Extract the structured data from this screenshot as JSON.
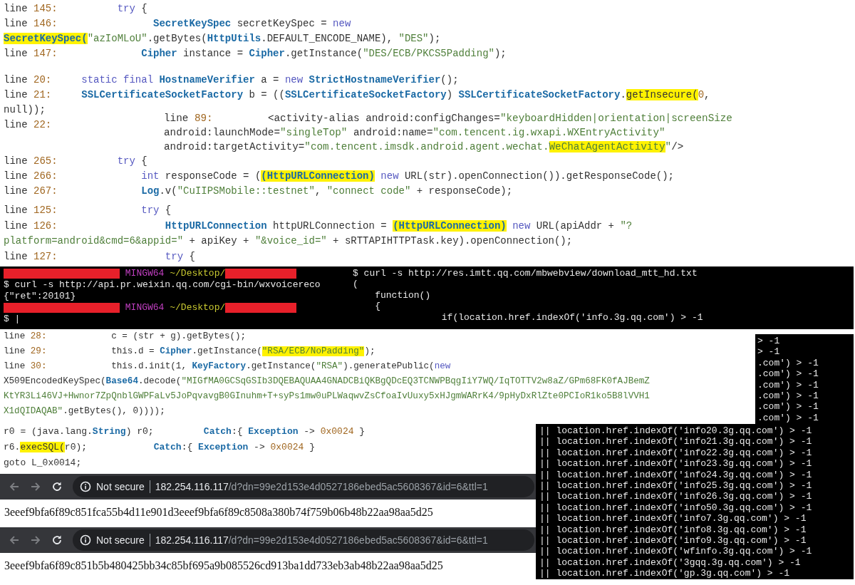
{
  "panels": [
    {
      "kind": "code",
      "lines": [
        {
          "label": "line",
          "number": "145:",
          "segments": [
            {
              "text": "          try",
              "kind": "keyword"
            },
            {
              "text": " {",
              "kind": "plain"
            }
          ]
        },
        {
          "label": "line",
          "number": "146:",
          "segments": [
            {
              "text": "                SecretKeySpec",
              "kind": "type"
            },
            {
              "text": " secretKeySpec = ",
              "kind": "plain"
            },
            {
              "text": "new",
              "kind": "keyword"
            }
          ]
        },
        {
          "segments": [
            {
              "text": "SecretKeySpec(",
              "kind": "type",
              "highlighted": true
            },
            {
              "text": "\"azIoMLoU\"",
              "kind": "string"
            },
            {
              "text": ".getBytes(",
              "kind": "plain"
            },
            {
              "text": "HttpUtils",
              "kind": "type"
            },
            {
              "text": ".DEFAULT_ENCODE_NAME), ",
              "kind": "plain"
            },
            {
              "text": "\"DES\"",
              "kind": "string"
            },
            {
              "text": ");",
              "kind": "plain"
            }
          ]
        },
        {
          "label": "line",
          "number": "147:",
          "segments": [
            {
              "text": "              Cipher",
              "kind": "type"
            },
            {
              "text": " instance = ",
              "kind": "plain"
            },
            {
              "text": "Cipher",
              "kind": "type"
            },
            {
              "text": ".getInstance(",
              "kind": "plain"
            },
            {
              "text": "\"DES/ECB/PKCS5Padding\"",
              "kind": "string"
            },
            {
              "text": ");",
              "kind": "plain"
            }
          ]
        }
      ]
    },
    {
      "kind": "code",
      "lines": [
        {
          "label": "line",
          "number": "20:",
          "segments": [
            {
              "text": "     static final ",
              "kind": "keyword"
            },
            {
              "text": "HostnameVerifier",
              "kind": "type"
            },
            {
              "text": " a = ",
              "kind": "plain"
            },
            {
              "text": "new ",
              "kind": "keyword"
            },
            {
              "text": "StrictHostnameVerifier",
              "kind": "type"
            },
            {
              "text": "();",
              "kind": "plain"
            }
          ]
        },
        {
          "label": "line",
          "number": "21:",
          "segments": [
            {
              "text": "     SSLCertificateSocketFactory",
              "kind": "type"
            },
            {
              "text": " b = ((",
              "kind": "plain"
            },
            {
              "text": "SSLCertificateSocketFactory",
              "kind": "type"
            },
            {
              "text": ") ",
              "kind": "plain"
            },
            {
              "text": "SSLCertificateSocketFactory",
              "kind": "type"
            },
            {
              "text": ".",
              "kind": "plain"
            },
            {
              "text": "getInsecure(",
              "kind": "plain",
              "highlighted": true
            },
            {
              "text": "0",
              "kind": "number"
            },
            {
              "text": ",",
              "kind": "plain"
            }
          ]
        },
        {
          "segments": [
            {
              "text": "null));",
              "kind": "plain"
            }
          ]
        },
        {
          "label": "line",
          "number": "22:"
        }
      ]
    },
    {
      "kind": "code",
      "lines": [
        {
          "label": "line",
          "number": "89:",
          "segments": [
            {
              "text": "         <activity-alias android:configChanges=",
              "kind": "plain"
            },
            {
              "text": "\"keyboardHidden|orientation|screenSize",
              "kind": "string"
            }
          ]
        },
        {
          "segments": [
            {
              "text": "android:launchMode=",
              "kind": "plain"
            },
            {
              "text": "\"singleTop\"",
              "kind": "string"
            },
            {
              "text": " android:name=",
              "kind": "plain"
            },
            {
              "text": "\"com.tencent.ig.wxapi.WXEntryActivity\"",
              "kind": "string"
            }
          ]
        },
        {
          "segments": [
            {
              "text": "android:targetActivity=",
              "kind": "plain"
            },
            {
              "text": "\"com.tencent.imsdk.android.agent.wechat.",
              "kind": "string"
            },
            {
              "text": "WeChatAgentActivity",
              "kind": "string",
              "highlighted": true
            },
            {
              "text": "\"",
              "kind": "string"
            },
            {
              "text": "/>",
              "kind": "plain"
            }
          ]
        }
      ]
    },
    {
      "kind": "code",
      "lines": [
        {
          "label": "line",
          "number": "265:",
          "segments": [
            {
              "text": "          try",
              "kind": "keyword"
            },
            {
              "text": " {",
              "kind": "plain"
            }
          ]
        },
        {
          "label": "line",
          "number": "266:",
          "segments": [
            {
              "text": "              int",
              "kind": "keyword"
            },
            {
              "text": " responseCode = (",
              "kind": "plain"
            },
            {
              "text": "(HttpURLConnection)",
              "kind": "type",
              "highlighted": true
            },
            {
              "text": " new",
              "kind": "keyword"
            },
            {
              "text": " URL(str).openConnection()).getResponseCode();",
              "kind": "plain"
            }
          ]
        },
        {
          "label": "line",
          "number": "267:",
          "segments": [
            {
              "text": "              Log",
              "kind": "type"
            },
            {
              "text": ".v(",
              "kind": "plain"
            },
            {
              "text": "\"CuIIPSMobile::testnet\"",
              "kind": "string"
            },
            {
              "text": ", ",
              "kind": "plain"
            },
            {
              "text": "\"connect code\"",
              "kind": "string"
            },
            {
              "text": " + responseCode);",
              "kind": "plain"
            }
          ]
        }
      ]
    },
    {
      "kind": "code",
      "lines": [
        {
          "label": "line",
          "number": "125:",
          "segments": [
            {
              "text": "              try",
              "kind": "keyword"
            },
            {
              "text": " {",
              "kind": "plain"
            }
          ]
        },
        {
          "label": "line",
          "number": "126:",
          "segments": [
            {
              "text": "                  HttpURLConnection",
              "kind": "type"
            },
            {
              "text": " httpURLConnection = ",
              "kind": "plain"
            },
            {
              "text": "(HttpURLConnection)",
              "kind": "type",
              "highlighted": true
            },
            {
              "text": " new",
              "kind": "keyword"
            },
            {
              "text": " URL(apiAddr + ",
              "kind": "plain"
            },
            {
              "text": "\"?",
              "kind": "string"
            }
          ]
        },
        {
          "segments": [
            {
              "text": "platform=android&cmd=6&appid=\"",
              "kind": "string"
            },
            {
              "text": " + apiKey + ",
              "kind": "plain"
            },
            {
              "text": "\"&voice_id=\"",
              "kind": "string"
            },
            {
              "text": " + sRTTAPIHTTPTask.key).openConnection();",
              "kind": "plain"
            }
          ]
        },
        {
          "label": "line",
          "number": "127:",
          "segments": [
            {
              "text": "                  try",
              "kind": "keyword"
            },
            {
              "text": " {",
              "kind": "plain"
            }
          ]
        }
      ]
    },
    {
      "kind": "terminal",
      "lines": [
        {
          "segments": [
            {
              "kind": "redacted"
            },
            {
              "text": " MINGW64",
              "kind": "host"
            },
            {
              "text": " ~/Desktop/",
              "kind": "path"
            },
            {
              "kind": "redacted"
            }
          ]
        },
        {
          "segments": [
            {
              "text": "$ curl -s http://api.pr.weixin.qq.com/cgi-bin/wxvoicereco",
              "kind": "plain"
            }
          ]
        },
        {
          "segments": [
            {
              "text": "{\"ret\":20101}",
              "kind": "plain"
            }
          ]
        },
        {
          "segments": [
            {
              "kind": "redacted"
            },
            {
              "text": " MINGW64",
              "kind": "host"
            },
            {
              "text": " ~/Desktop/",
              "kind": "path"
            },
            {
              "kind": "redacted"
            }
          ]
        },
        {
          "segments": [
            {
              "text": "$ |",
              "kind": "plain"
            }
          ]
        }
      ]
    },
    {
      "kind": "terminal",
      "lines": [
        {
          "segments": [
            {
              "text": "$ curl -s http://res.imtt.qq.com/mbwebview/download_mtt_hd.txt",
              "kind": "plain"
            }
          ]
        },
        {
          "segments": [
            {
              "text": "(",
              "kind": "plain"
            }
          ]
        },
        {
          "segments": [
            {
              "text": "    function()",
              "kind": "plain"
            }
          ]
        },
        {
          "segments": [
            {
              "text": "    {",
              "kind": "plain"
            }
          ]
        },
        {
          "segments": [
            {
              "text": "                if(location.href.indexOf('info.3g.qq.com') > -1",
              "kind": "plain"
            }
          ]
        }
      ]
    },
    {
      "kind": "terminal",
      "lines": [
        {
          "segments": [
            {
              "text": "> -1",
              "kind": "plain"
            }
          ]
        },
        {
          "segments": [
            {
              "text": "> -1",
              "kind": "plain"
            }
          ]
        },
        {
          "segments": [
            {
              "text": ".com') > -1",
              "kind": "plain"
            }
          ]
        },
        {
          "segments": [
            {
              "text": ".com') > -1",
              "kind": "plain"
            }
          ]
        },
        {
          "segments": [
            {
              "text": ".com') > -1",
              "kind": "plain"
            }
          ]
        },
        {
          "segments": [
            {
              "text": ".com') > -1",
              "kind": "plain"
            }
          ]
        },
        {
          "segments": [
            {
              "text": ".com') > -1",
              "kind": "plain"
            }
          ]
        },
        {
          "segments": [
            {
              "text": ".com') > -1",
              "kind": "plain"
            }
          ]
        }
      ]
    },
    {
      "kind": "code",
      "lines": [
        {
          "label": "line",
          "number": "28:",
          "segments": [
            {
              "text": "            c = (str + g).getBytes();",
              "kind": "plain"
            }
          ]
        },
        {
          "label": "line",
          "number": "29:",
          "segments": [
            {
              "text": "            this.d = ",
              "kind": "plain"
            },
            {
              "text": "Cipher",
              "kind": "type"
            },
            {
              "text": ".getInstance(",
              "kind": "plain"
            },
            {
              "text": "\"RSA/ECB/NoPadding\"",
              "kind": "string",
              "highlighted": true
            },
            {
              "text": ");",
              "kind": "plain"
            }
          ]
        },
        {
          "label": "line",
          "number": "30:",
          "segments": [
            {
              "text": "            this.d.init(1, ",
              "kind": "plain"
            },
            {
              "text": "KeyFactory",
              "kind": "type"
            },
            {
              "text": ".getInstance(",
              "kind": "plain"
            },
            {
              "text": "\"RSA\"",
              "kind": "string"
            },
            {
              "text": ").generatePublic(",
              "kind": "plain"
            },
            {
              "text": "new",
              "kind": "keyword"
            }
          ]
        },
        {
          "segments": [
            {
              "text": "X509EncodedKeySpec(",
              "kind": "plain"
            },
            {
              "text": "Base64",
              "kind": "type"
            },
            {
              "text": ".decode(",
              "kind": "plain"
            },
            {
              "text": "\"MIGfMA0GCSqGSIb3DQEBAQUAA4GNADCBiQKBgQDcEQ3TCNWPBqgIiY7WQ/IqTOTTV2w8aZ/GPm68FK0fAJBemZ",
              "kind": "string"
            }
          ]
        },
        {
          "segments": [
            {
              "text": "KtYR3Li46VJ+Hwnor7ZpQnblGWPFaLv5JoPqvavgB0GInuhm+T+syPs1mw0uPLWaqwvZsCfoaIvUuxy5xHJgmWARrK4/9pHyDxRlZte0PCIoR1ko5B8lVVH1",
              "kind": "string"
            }
          ]
        },
        {
          "segments": [
            {
              "text": "X1dQIDAQAB\"",
              "kind": "string"
            },
            {
              "text": ".getBytes(), 0))));",
              "kind": "plain"
            }
          ]
        }
      ]
    },
    {
      "kind": "code",
      "lines": [
        {
          "segments": [
            {
              "text": "r0 = (java.lang.",
              "kind": "plain"
            },
            {
              "text": "String",
              "kind": "type"
            },
            {
              "text": ") r0;         ",
              "kind": "plain"
            },
            {
              "text": "Catch",
              "kind": "type"
            },
            {
              "text": ":{ ",
              "kind": "plain"
            },
            {
              "text": "Exception",
              "kind": "type"
            },
            {
              "text": " -> ",
              "kind": "plain"
            },
            {
              "text": "0x0024",
              "kind": "number"
            },
            {
              "text": " }",
              "kind": "plain"
            }
          ]
        },
        {
          "segments": [
            {
              "text": "r6.",
              "kind": "plain"
            },
            {
              "text": "execSQL(",
              "kind": "plain",
              "highlighted": true
            },
            {
              "text": "r0);            ",
              "kind": "plain"
            },
            {
              "text": "Catch",
              "kind": "type"
            },
            {
              "text": ":{ ",
              "kind": "plain"
            },
            {
              "text": "Exception",
              "kind": "type"
            },
            {
              "text": " -> ",
              "kind": "plain"
            },
            {
              "text": "0x0024",
              "kind": "number"
            },
            {
              "text": " }",
              "kind": "plain"
            }
          ]
        },
        {
          "segments": [
            {
              "text": "goto L_0x0014;",
              "kind": "plain"
            }
          ]
        }
      ]
    },
    {
      "kind": "browser",
      "security": "Not secure",
      "host": "182.254.116.117",
      "path": "/d?dn=99e2d153e4d0527186ebed5ac5608367&id=6&ttl=1",
      "page_text": "3eeef9bfa6f89c851fca55b4d11e901d3eeef9bfa6f89c8508a380b74f759b06b48b22aa98aa5d25"
    },
    {
      "kind": "browser",
      "security": "Not secure",
      "host": "182.254.116.117",
      "path": "/d?dn=99e2d153e4d0527186ebed5ac5608367&id=6&ttl=1",
      "page_text": "3eeef9bfa6f89c851b5b480425bb34c85bf695a9b085526cd913ba1dd733eb3ab48b22aa98aa5d25"
    },
    {
      "kind": "terminal",
      "lines": [
        {
          "segments": [
            {
              "text": "|| location.href.indexOf('info20.3g.qq.com') > -1",
              "kind": "plain"
            }
          ]
        },
        {
          "segments": [
            {
              "text": "|| location.href.indexOf('info21.3g.qq.com') > -1",
              "kind": "plain"
            }
          ]
        },
        {
          "segments": [
            {
              "text": "|| location.href.indexOf('info22.3g.qq.com') > -1",
              "kind": "plain"
            }
          ]
        },
        {
          "segments": [
            {
              "text": "|| location.href.indexOf('info23.3g.qq.com') > -1",
              "kind": "plain"
            }
          ]
        },
        {
          "segments": [
            {
              "text": "|| location.href.indexOf('info24.3g.qq.com') > -1",
              "kind": "plain"
            }
          ]
        },
        {
          "segments": [
            {
              "text": "|| location.href.indexOf('info25.3g.qq.com') > -1",
              "kind": "plain"
            }
          ]
        },
        {
          "segments": [
            {
              "text": "|| location.href.indexOf('info26.3g.qq.com') > -1",
              "kind": "plain"
            }
          ]
        },
        {
          "segments": [
            {
              "text": "|| location.href.indexOf('info50.3g.qq.com') > -1",
              "kind": "plain"
            }
          ]
        },
        {
          "segments": [
            {
              "text": "|| location.href.indexOf('info7.3g.qq.com') > -1",
              "kind": "plain"
            }
          ]
        },
        {
          "segments": [
            {
              "text": "|| location.href.indexOf('info8.3g.qq.com') > -1",
              "kind": "plain"
            }
          ]
        },
        {
          "segments": [
            {
              "text": "|| location.href.indexOf('info9.3g.qq.com') > -1",
              "kind": "plain"
            }
          ]
        },
        {
          "segments": [
            {
              "text": "|| location.href.indexOf('wfinfo.3g.qq.com') > -1",
              "kind": "plain"
            }
          ]
        },
        {
          "segments": [
            {
              "text": "|| location.href.indexOf('3gqq.3g.qq.com') > -1",
              "kind": "plain"
            }
          ]
        },
        {
          "segments": [
            {
              "text": "|| location.href.indexOf('gp.3g.qq.com') > -1",
              "kind": "plain"
            }
          ]
        }
      ]
    }
  ]
}
